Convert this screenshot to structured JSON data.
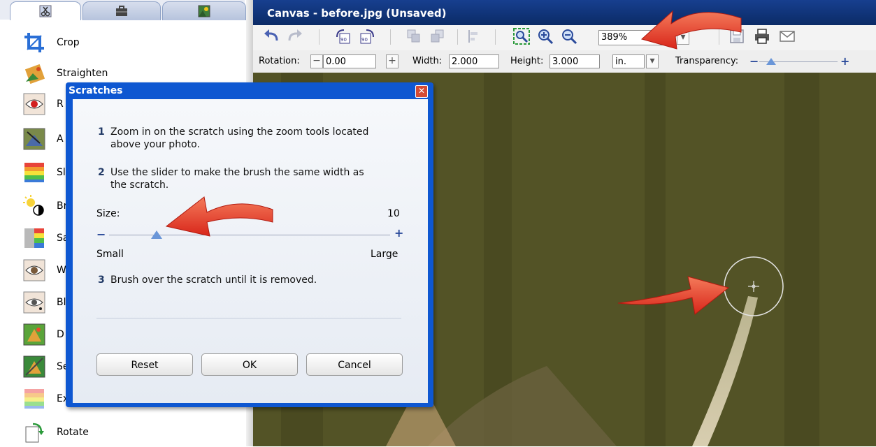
{
  "left_panel": {
    "tabs": [
      {
        "icon": "scissors-icon"
      },
      {
        "icon": "toolbox-icon"
      },
      {
        "icon": "picture-icon"
      }
    ],
    "tools": [
      {
        "label": "Crop",
        "icon": "crop-icon"
      },
      {
        "label": "Straighten",
        "icon": "straighten-icon"
      },
      {
        "label": "R",
        "icon": "red-eye-icon"
      },
      {
        "label": "A",
        "icon": "auto-fix-icon"
      },
      {
        "label": "Sl",
        "icon": "color-swatch-icon"
      },
      {
        "label": "Br",
        "icon": "brightness-icon"
      },
      {
        "label": "Sa",
        "icon": "saturation-icon"
      },
      {
        "label": "W",
        "icon": "eye-whiten-icon"
      },
      {
        "label": "Bl",
        "icon": "eye-icon"
      },
      {
        "label": "D",
        "icon": "effects-icon"
      },
      {
        "label": "Se",
        "icon": "sepia-icon"
      },
      {
        "label": "Ex",
        "icon": "exposure-icon"
      },
      {
        "label": "Rotate",
        "icon": "rotate-icon"
      }
    ]
  },
  "canvas": {
    "title": "Canvas - before.jpg (Unsaved)",
    "zoom_value": "389%",
    "rotation_label": "Rotation:",
    "rotation_value": "0.00",
    "width_label": "Width:",
    "width_value": "2.000",
    "height_label": "Height:",
    "height_value": "3.000",
    "unit": "in.",
    "transparency_label": "Transparency:",
    "transparency_level": 0.15
  },
  "dialog": {
    "title": "Scratches",
    "steps": [
      {
        "num": "1",
        "line1": "Zoom in on the scratch using the zoom tools located",
        "line2": "above your photo."
      },
      {
        "num": "2",
        "line1": "Use the slider to make the brush the same width as",
        "line2": "the scratch."
      },
      {
        "num": "3",
        "line1": "Brush over the scratch until it is removed.",
        "line2": ""
      }
    ],
    "size_label": "Size:",
    "size_value": "10",
    "size_level": 0.17,
    "minus": "−",
    "plus": "+",
    "small_label": "Small",
    "large_label": "Large",
    "buttons": {
      "reset": "Reset",
      "ok": "OK",
      "cancel": "Cancel"
    }
  },
  "colors": {
    "titlebar": "#0b2b66",
    "dialog_frame": "#0e57d1",
    "arrow": "#e53a24"
  }
}
